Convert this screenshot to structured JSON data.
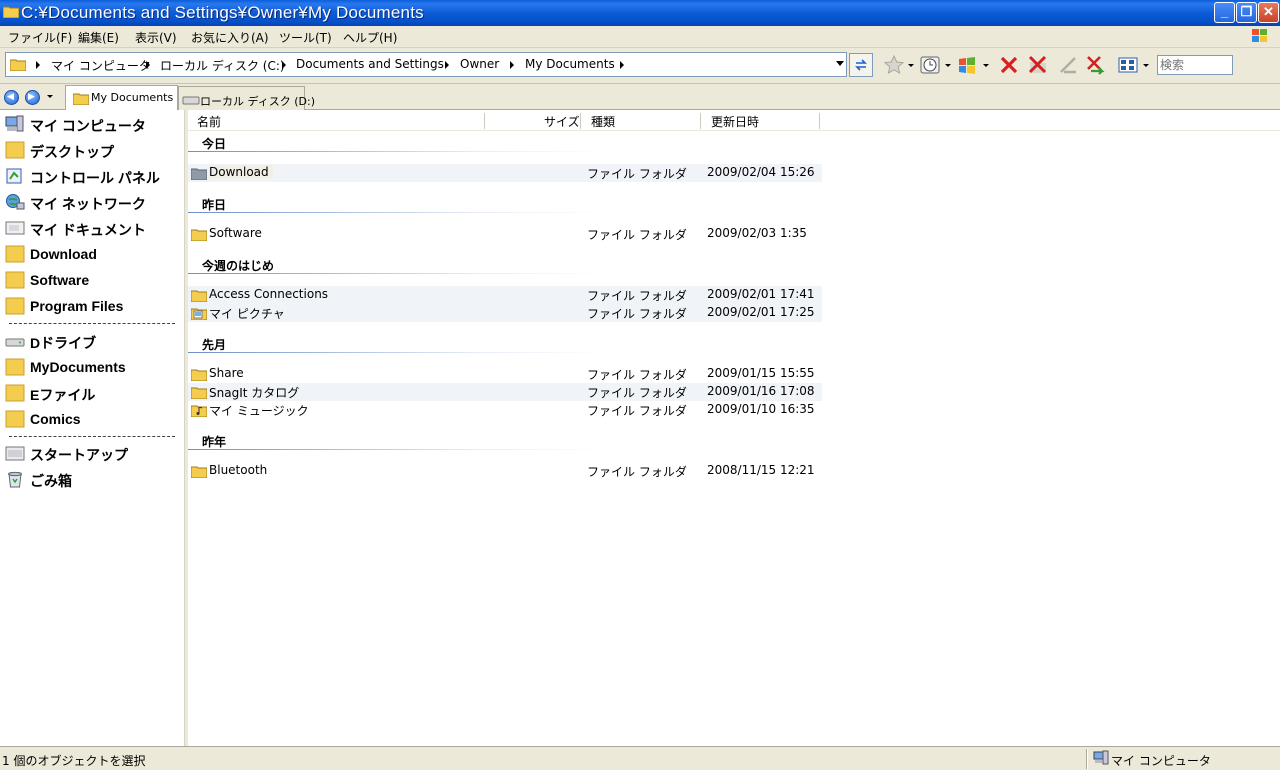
{
  "window": {
    "title": "C:¥Documents and Settings¥Owner¥My Documents",
    "minimize": "_",
    "restore": "❐",
    "close": "✕"
  },
  "menu": [
    "ファイル(F)",
    "編集(E)",
    "表示(V)",
    "お気に入り(A)",
    "ツール(T)",
    "ヘルプ(H)"
  ],
  "address": {
    "crumbs": [
      "マイ コンピュータ",
      "ローカル ディスク (C:)",
      "Documents and Settings",
      "Owner",
      "My Documents"
    ]
  },
  "search": {
    "placeholder": "検索"
  },
  "tabs": [
    {
      "label": "My Documents",
      "active": true
    },
    {
      "label": "ローカル ディスク (D:)",
      "active": false
    }
  ],
  "favorites": {
    "group1": [
      "マイ コンピュータ",
      "デスクトップ",
      "コントロール パネル",
      "マイ ネットワーク",
      "マイ ドキュメント",
      "Download",
      "Software",
      "Program Files"
    ],
    "group2": [
      "Dドライブ",
      "MyDocuments",
      "Eファイル",
      "Comics"
    ],
    "group3": [
      "スタートアップ",
      "ごみ箱"
    ]
  },
  "columns": {
    "name": "名前",
    "size": "サイズ",
    "type": "種類",
    "modified": "更新日時"
  },
  "groups": [
    {
      "header": "今日",
      "rows": [
        {
          "name": "Download",
          "type": "ファイル フォルダ",
          "date": "2009/02/04 15:26",
          "icon": "folder-gray-icon",
          "selected": true
        }
      ]
    },
    {
      "header": "昨日",
      "rows": [
        {
          "name": "Software",
          "type": "ファイル フォルダ",
          "date": "2009/02/03 1:35",
          "icon": "folder-icon"
        }
      ]
    },
    {
      "header": "今週のはじめ",
      "rows": [
        {
          "name": "Access Connections",
          "type": "ファイル フォルダ",
          "date": "2009/02/01 17:41",
          "icon": "folder-icon"
        },
        {
          "name": "マイ ピクチャ",
          "type": "ファイル フォルダ",
          "date": "2009/02/01 17:25",
          "icon": "pictures-folder-icon"
        }
      ]
    },
    {
      "header": "先月",
      "rows": [
        {
          "name": "Share",
          "type": "ファイル フォルダ",
          "date": "2009/01/15 15:55",
          "icon": "folder-icon"
        },
        {
          "name": "SnagIt カタログ",
          "type": "ファイル フォルダ",
          "date": "2009/01/16 17:08",
          "icon": "folder-icon"
        },
        {
          "name": "マイ ミュージック",
          "type": "ファイル フォルダ",
          "date": "2009/01/10 16:35",
          "icon": "music-folder-icon"
        }
      ]
    },
    {
      "header": "昨年",
      "rows": [
        {
          "name": "Bluetooth",
          "type": "ファイル フォルダ",
          "date": "2008/11/15 12:21",
          "icon": "folder-icon"
        }
      ]
    }
  ],
  "status": {
    "selection": "1 個のオブジェクトを選択",
    "location": "マイ コンピュータ"
  },
  "colors": {
    "titlebar": "#0c5bd6",
    "folder": "#f5cd4e",
    "groupline": "#6b8fc8"
  }
}
